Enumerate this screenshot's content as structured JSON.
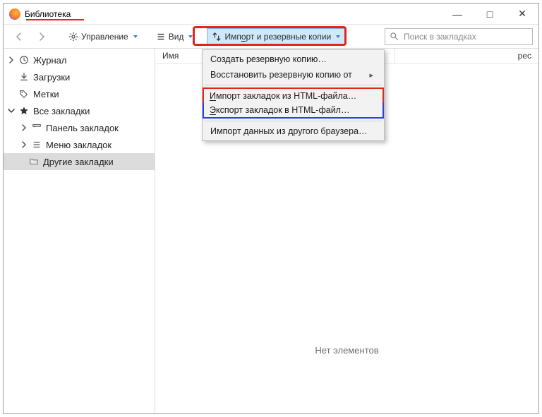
{
  "titlebar": {
    "title": "Библиотека"
  },
  "toolbar": {
    "manage_label": "Управление",
    "view_label": "Вид",
    "import_label": "Импорт и резервные копии"
  },
  "search": {
    "placeholder": "Поиск в закладках"
  },
  "columns": {
    "name": "Имя",
    "address": "рес"
  },
  "sidebar": {
    "history": "Журнал",
    "downloads": "Загрузки",
    "tags": "Метки",
    "all_bookmarks": "Все закладки",
    "toolbar_bm": "Панель закладок",
    "menu_bm": "Меню закладок",
    "other_bm": "Другие закладки"
  },
  "menu": {
    "backup": "Создать резервную копию…",
    "restore": "Восстановить резервную копию от",
    "import_html": "Импорт закладок из HTML-файла…",
    "export_html": "Экспорт закладок в HTML-файл…",
    "import_browser": "Импорт данных из другого браузера…"
  },
  "content": {
    "empty": "Нет элементов"
  }
}
